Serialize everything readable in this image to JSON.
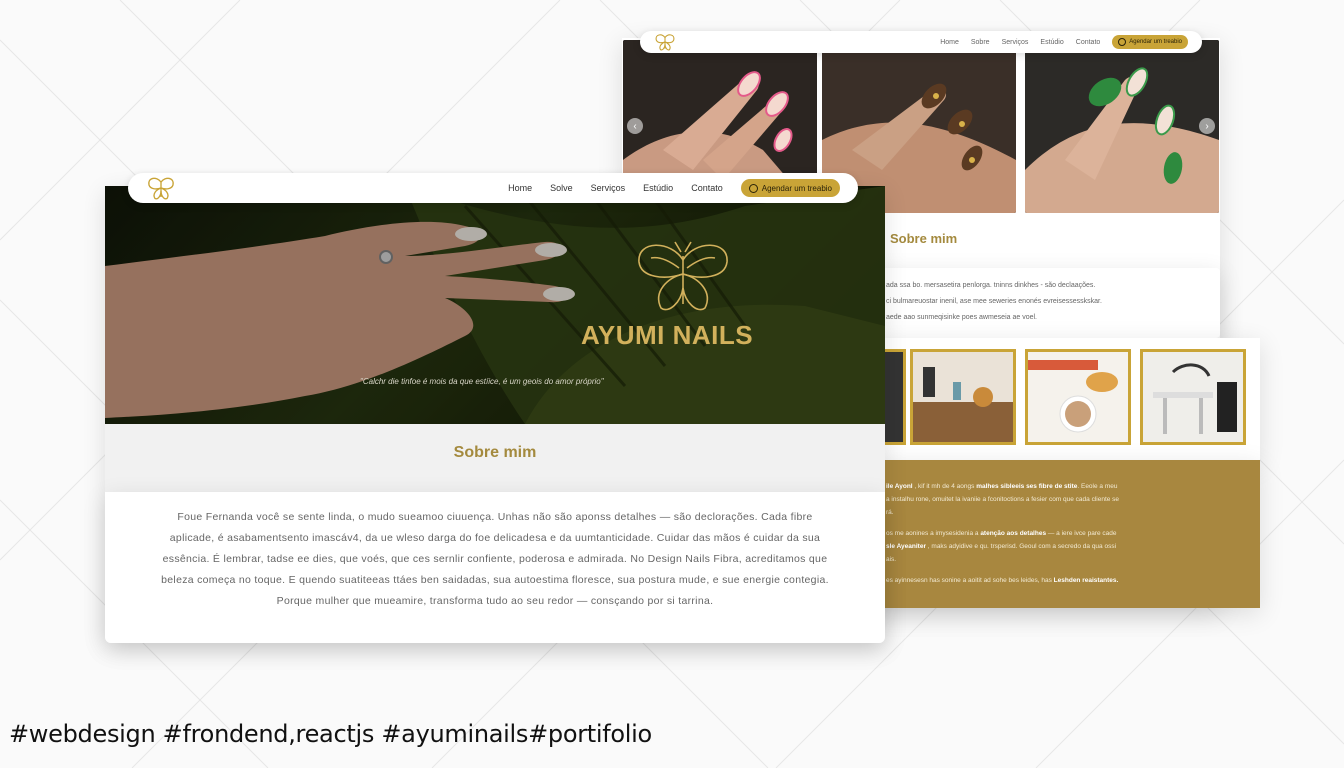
{
  "front": {
    "nav": {
      "links": [
        "Home",
        "Solve",
        "Serviços",
        "Estúdio",
        "Contato"
      ],
      "cta_label": "Agendar um treabio"
    },
    "hero": {
      "brand": "AYUMI NAILS",
      "quote": "\"Calchr die tinfoe é mois da que estíice, é um geois do amor próprio\""
    },
    "about": {
      "title": "Sobre mim",
      "text": "Foue Fernanda você se sente linda, o mudo sueamoo ciuuença. Unhas não são aponss detalhes — são declorações. Cada fibre aplicade, é asabamentsento imascáv4, da ue wleso darga do foe delicadesa e da uumtanticidade. Cuidar das mãos é cuidar da sua essência. É lembrar, tadse ee dies, que voés, que ces sernlir confiente, poderosa e admirada. No Design Nails Fibra, acreditamos que beleza começa no toque. E quendo suatiteeas ttáes ben saidadas, sua autoestima floresce, sua postura mude, e sue energie contegia. Porque mulher que mueamire, transforma tudo ao seu redor — consçando por si tarrina."
    }
  },
  "back": {
    "nav": {
      "links": [
        "Home",
        "Sobre",
        "Serviços",
        "Estúdio",
        "Contato"
      ],
      "cta_label": "Agendar um treabio"
    },
    "about": {
      "title": "Sobre mim",
      "lines": [
        "ada ssa bo. mersasetira penlorga. tninns dinkhes  - são declaações.",
        "ci bulmareuostar inenil, ase mee seweries enonés evreisessesskskar.",
        "aede aao sunmeqisinke poes awmeseia ae voel."
      ]
    },
    "gold": {
      "lines": [
        [
          "ile Ayonl",
          " , kif it mh de 4 aongs ",
          "malhes sibleeis ses fibre de stite",
          ". Eeole a meu"
        ],
        [
          "",
          "a instalhu rone, omuitet la ivaniie a fconitoctions a fesier com que cada cliente se",
          "",
          ""
        ],
        [
          "",
          "rá.",
          "",
          ""
        ],
        [
          "",
          "os me aonines a imysesidenia a ",
          "atenção aos detalhes",
          " — a iere ivce pare cade"
        ],
        [
          "sle Ayeaniter",
          " , maks adyidive e qu. trsperisd. Geoul com a secredo da qua ossi",
          "",
          ""
        ],
        [
          "",
          "ais.",
          "",
          ""
        ],
        [
          "",
          "es ayinnesesn has sonine a aoitit ad sohe bes leides, has ",
          "Leshden reaistantes.",
          ""
        ]
      ]
    }
  },
  "hashtags": "#webdesign #frondend,reactjs #ayuminails#portifolio",
  "colors": {
    "gold": "#c9a437",
    "gold_dark": "#a8873f",
    "title_gold": "#a48a3e"
  }
}
